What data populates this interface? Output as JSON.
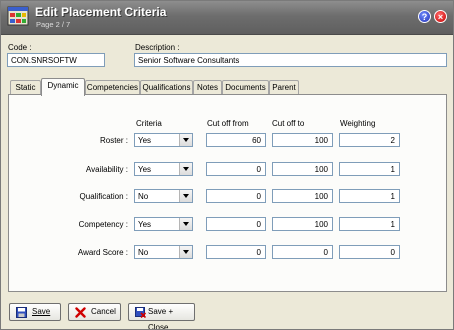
{
  "window": {
    "title": "Edit Placement Criteria",
    "subtitle": "Page 2 / 7",
    "help_label": "?",
    "close_label": "×"
  },
  "fields": {
    "code_label": "Code :",
    "code_value": "CON.SNRSOFTW",
    "description_label": "Description :",
    "description_value": "Senior Software Consultants"
  },
  "tabs": [
    "Static",
    "Dynamic",
    "Competencies",
    "Qualifications",
    "Notes",
    "Documents",
    "Parent"
  ],
  "active_tab": "Dynamic",
  "grid": {
    "headers": [
      "Criteria",
      "Cut off from",
      "Cut off to",
      "Weighting"
    ],
    "rows": [
      {
        "label": "Roster :",
        "criteria": "Yes",
        "from": "60",
        "to": "100",
        "weight": "2"
      },
      {
        "label": "Availability :",
        "criteria": "Yes",
        "from": "0",
        "to": "100",
        "weight": "1"
      },
      {
        "label": "Qualification :",
        "criteria": "No",
        "from": "0",
        "to": "100",
        "weight": "1"
      },
      {
        "label": "Competency :",
        "criteria": "Yes",
        "from": "0",
        "to": "100",
        "weight": "1"
      },
      {
        "label": "Award Score :",
        "criteria": "No",
        "from": "0",
        "to": "0",
        "weight": "0"
      }
    ]
  },
  "buttons": {
    "save": "Save",
    "cancel": "Cancel",
    "save_close": "Save + Close"
  },
  "icons": {
    "app": "placement-criteria-icon",
    "save": "floppy-disk-icon",
    "cancel": "red-x-icon",
    "save_close": "floppy-disk-close-icon"
  }
}
